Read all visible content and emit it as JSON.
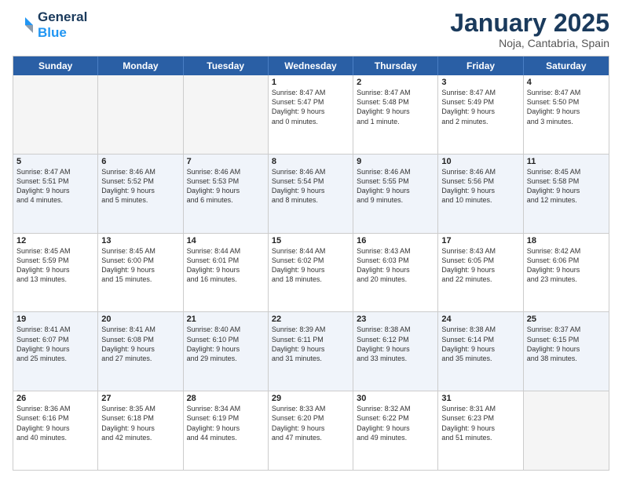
{
  "header": {
    "logo_line1": "General",
    "logo_line2": "Blue",
    "month_title": "January 2025",
    "location": "Noja, Cantabria, Spain"
  },
  "weekdays": [
    "Sunday",
    "Monday",
    "Tuesday",
    "Wednesday",
    "Thursday",
    "Friday",
    "Saturday"
  ],
  "rows": [
    {
      "alt": false,
      "cells": [
        {
          "day": "",
          "text": ""
        },
        {
          "day": "",
          "text": ""
        },
        {
          "day": "",
          "text": ""
        },
        {
          "day": "1",
          "text": "Sunrise: 8:47 AM\nSunset: 5:47 PM\nDaylight: 9 hours\nand 0 minutes."
        },
        {
          "day": "2",
          "text": "Sunrise: 8:47 AM\nSunset: 5:48 PM\nDaylight: 9 hours\nand 1 minute."
        },
        {
          "day": "3",
          "text": "Sunrise: 8:47 AM\nSunset: 5:49 PM\nDaylight: 9 hours\nand 2 minutes."
        },
        {
          "day": "4",
          "text": "Sunrise: 8:47 AM\nSunset: 5:50 PM\nDaylight: 9 hours\nand 3 minutes."
        }
      ]
    },
    {
      "alt": true,
      "cells": [
        {
          "day": "5",
          "text": "Sunrise: 8:47 AM\nSunset: 5:51 PM\nDaylight: 9 hours\nand 4 minutes."
        },
        {
          "day": "6",
          "text": "Sunrise: 8:46 AM\nSunset: 5:52 PM\nDaylight: 9 hours\nand 5 minutes."
        },
        {
          "day": "7",
          "text": "Sunrise: 8:46 AM\nSunset: 5:53 PM\nDaylight: 9 hours\nand 6 minutes."
        },
        {
          "day": "8",
          "text": "Sunrise: 8:46 AM\nSunset: 5:54 PM\nDaylight: 9 hours\nand 8 minutes."
        },
        {
          "day": "9",
          "text": "Sunrise: 8:46 AM\nSunset: 5:55 PM\nDaylight: 9 hours\nand 9 minutes."
        },
        {
          "day": "10",
          "text": "Sunrise: 8:46 AM\nSunset: 5:56 PM\nDaylight: 9 hours\nand 10 minutes."
        },
        {
          "day": "11",
          "text": "Sunrise: 8:45 AM\nSunset: 5:58 PM\nDaylight: 9 hours\nand 12 minutes."
        }
      ]
    },
    {
      "alt": false,
      "cells": [
        {
          "day": "12",
          "text": "Sunrise: 8:45 AM\nSunset: 5:59 PM\nDaylight: 9 hours\nand 13 minutes."
        },
        {
          "day": "13",
          "text": "Sunrise: 8:45 AM\nSunset: 6:00 PM\nDaylight: 9 hours\nand 15 minutes."
        },
        {
          "day": "14",
          "text": "Sunrise: 8:44 AM\nSunset: 6:01 PM\nDaylight: 9 hours\nand 16 minutes."
        },
        {
          "day": "15",
          "text": "Sunrise: 8:44 AM\nSunset: 6:02 PM\nDaylight: 9 hours\nand 18 minutes."
        },
        {
          "day": "16",
          "text": "Sunrise: 8:43 AM\nSunset: 6:03 PM\nDaylight: 9 hours\nand 20 minutes."
        },
        {
          "day": "17",
          "text": "Sunrise: 8:43 AM\nSunset: 6:05 PM\nDaylight: 9 hours\nand 22 minutes."
        },
        {
          "day": "18",
          "text": "Sunrise: 8:42 AM\nSunset: 6:06 PM\nDaylight: 9 hours\nand 23 minutes."
        }
      ]
    },
    {
      "alt": true,
      "cells": [
        {
          "day": "19",
          "text": "Sunrise: 8:41 AM\nSunset: 6:07 PM\nDaylight: 9 hours\nand 25 minutes."
        },
        {
          "day": "20",
          "text": "Sunrise: 8:41 AM\nSunset: 6:08 PM\nDaylight: 9 hours\nand 27 minutes."
        },
        {
          "day": "21",
          "text": "Sunrise: 8:40 AM\nSunset: 6:10 PM\nDaylight: 9 hours\nand 29 minutes."
        },
        {
          "day": "22",
          "text": "Sunrise: 8:39 AM\nSunset: 6:11 PM\nDaylight: 9 hours\nand 31 minutes."
        },
        {
          "day": "23",
          "text": "Sunrise: 8:38 AM\nSunset: 6:12 PM\nDaylight: 9 hours\nand 33 minutes."
        },
        {
          "day": "24",
          "text": "Sunrise: 8:38 AM\nSunset: 6:14 PM\nDaylight: 9 hours\nand 35 minutes."
        },
        {
          "day": "25",
          "text": "Sunrise: 8:37 AM\nSunset: 6:15 PM\nDaylight: 9 hours\nand 38 minutes."
        }
      ]
    },
    {
      "alt": false,
      "cells": [
        {
          "day": "26",
          "text": "Sunrise: 8:36 AM\nSunset: 6:16 PM\nDaylight: 9 hours\nand 40 minutes."
        },
        {
          "day": "27",
          "text": "Sunrise: 8:35 AM\nSunset: 6:18 PM\nDaylight: 9 hours\nand 42 minutes."
        },
        {
          "day": "28",
          "text": "Sunrise: 8:34 AM\nSunset: 6:19 PM\nDaylight: 9 hours\nand 44 minutes."
        },
        {
          "day": "29",
          "text": "Sunrise: 8:33 AM\nSunset: 6:20 PM\nDaylight: 9 hours\nand 47 minutes."
        },
        {
          "day": "30",
          "text": "Sunrise: 8:32 AM\nSunset: 6:22 PM\nDaylight: 9 hours\nand 49 minutes."
        },
        {
          "day": "31",
          "text": "Sunrise: 8:31 AM\nSunset: 6:23 PM\nDaylight: 9 hours\nand 51 minutes."
        },
        {
          "day": "",
          "text": ""
        }
      ]
    }
  ]
}
